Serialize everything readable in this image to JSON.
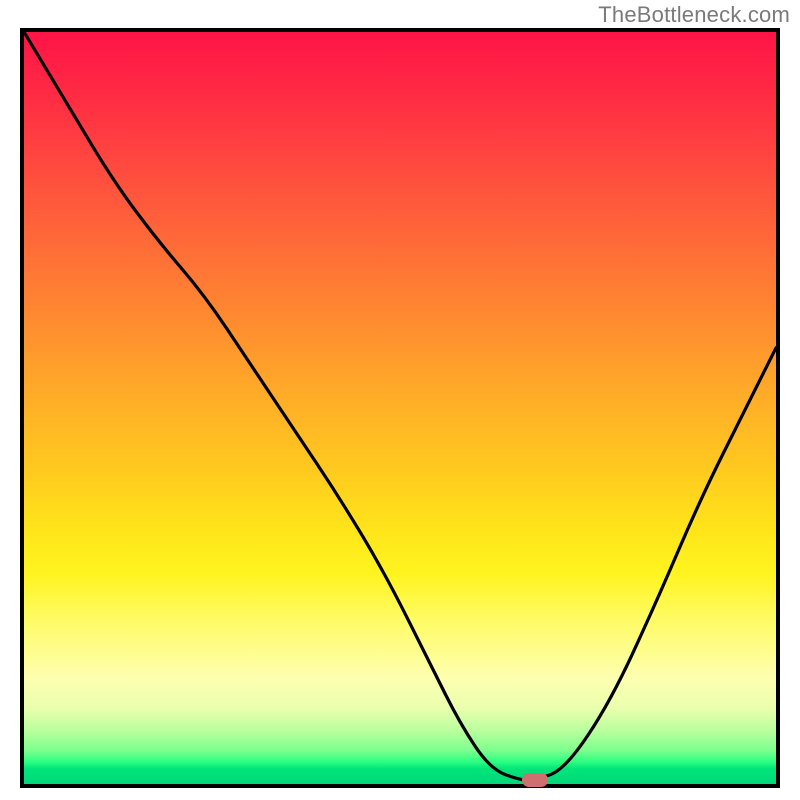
{
  "watermark": "TheBottleneck.com",
  "colors": {
    "frame": "#000000",
    "curve": "#000000",
    "marker": "#cf6f6f",
    "watermark_text": "#7a7a7a"
  },
  "chart_data": {
    "type": "line",
    "title": "",
    "xlabel": "",
    "ylabel": "",
    "xlim": [
      0,
      1
    ],
    "ylim": [
      0,
      1
    ],
    "series": [
      {
        "name": "bottleneck-curve",
        "x": [
          0.0,
          0.06,
          0.12,
          0.18,
          0.24,
          0.3,
          0.36,
          0.42,
          0.48,
          0.54,
          0.58,
          0.62,
          0.66,
          0.68,
          0.72,
          0.78,
          0.84,
          0.9,
          0.96,
          1.0
        ],
        "y": [
          1.0,
          0.9,
          0.8,
          0.72,
          0.65,
          0.56,
          0.47,
          0.38,
          0.28,
          0.16,
          0.08,
          0.02,
          0.005,
          0.005,
          0.02,
          0.11,
          0.24,
          0.38,
          0.5,
          0.58
        ]
      }
    ],
    "marker": {
      "x": 0.68,
      "y": 0.005,
      "label": ""
    },
    "annotations": []
  }
}
